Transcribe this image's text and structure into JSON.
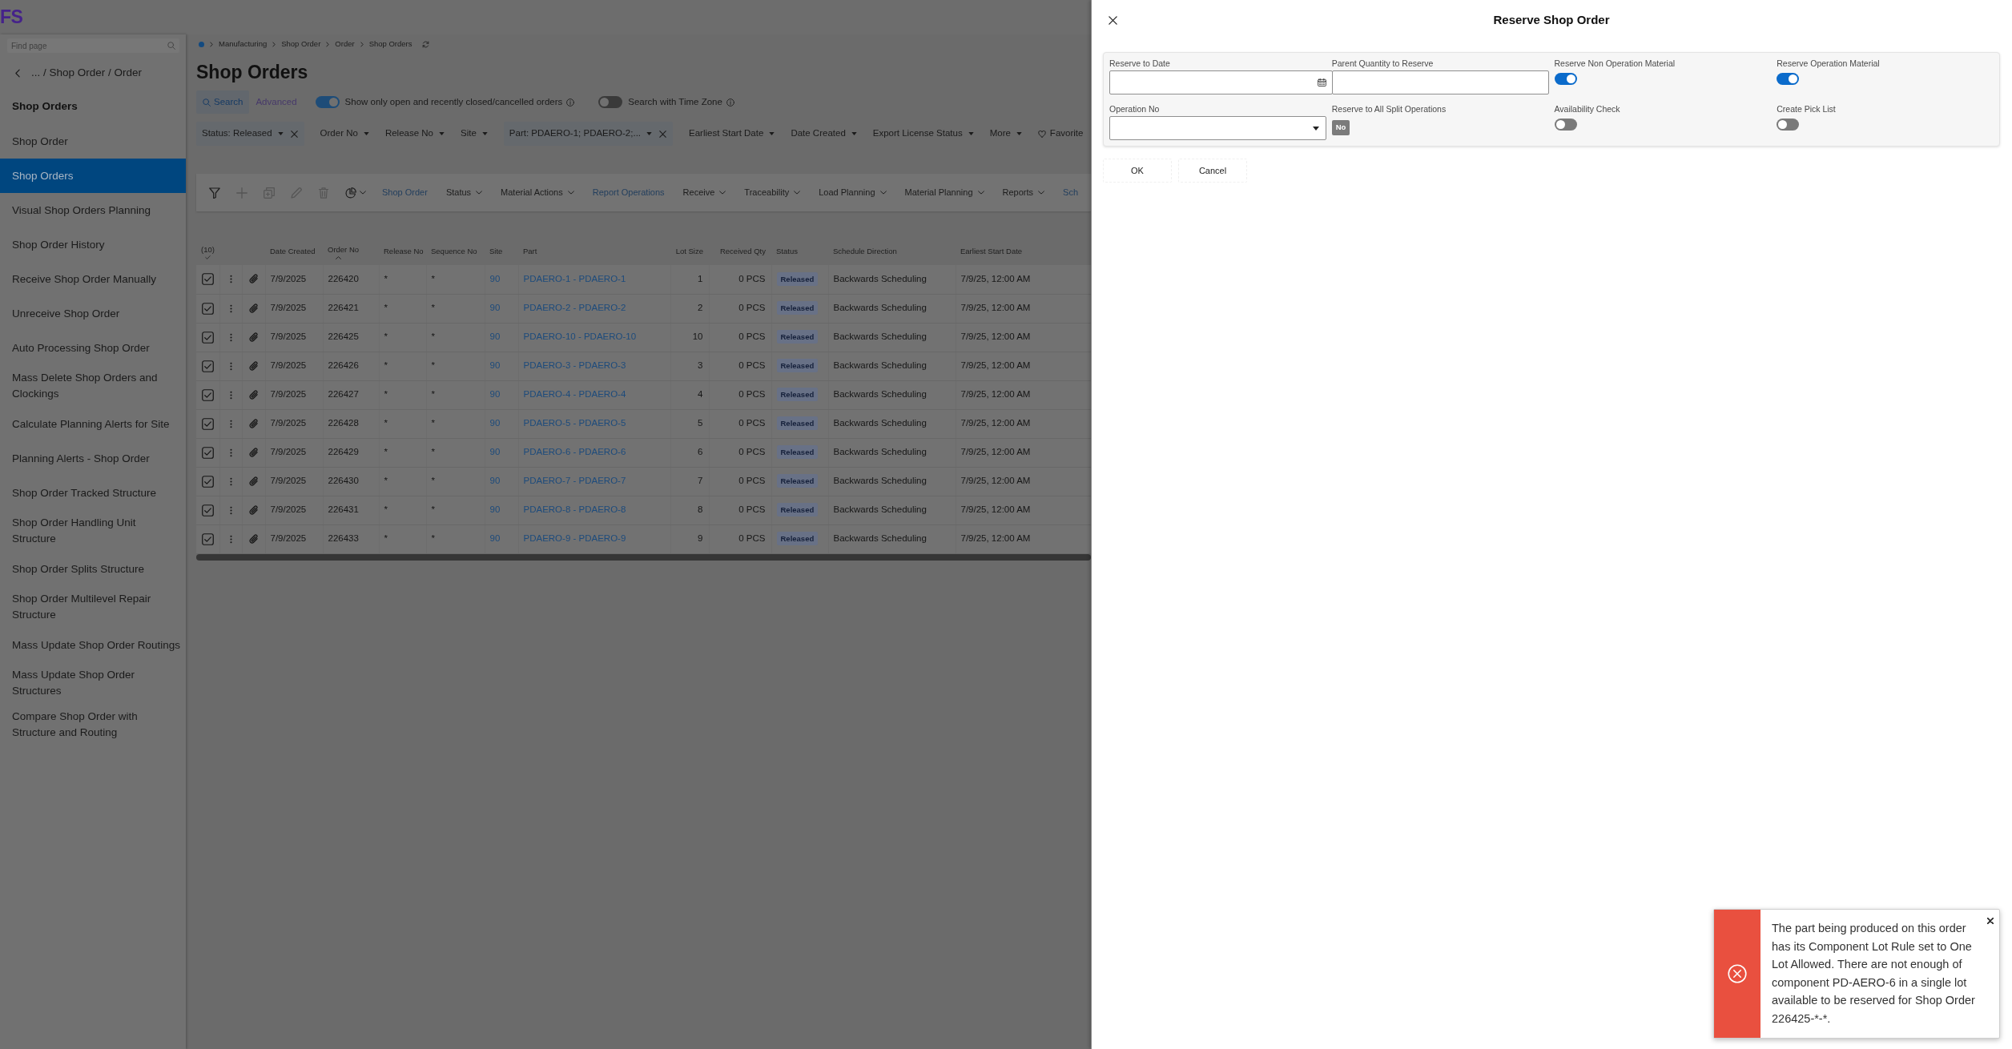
{
  "app": {
    "logo": "FS"
  },
  "sidebar": {
    "search": {
      "placeholder": "Find page"
    },
    "breadcrumb": "... / Shop Order / Order",
    "heading": "Shop Orders",
    "items": [
      {
        "label": "Shop Order",
        "selected": false
      },
      {
        "label": "Shop Orders",
        "selected": true
      },
      {
        "label": "Visual Shop Orders Planning",
        "selected": false
      },
      {
        "label": "Shop Order History",
        "selected": false
      },
      {
        "label": "Receive Shop Order Manually",
        "selected": false
      },
      {
        "label": "Unreceive Shop Order",
        "selected": false
      },
      {
        "label": "Auto Processing Shop Order",
        "selected": false
      },
      {
        "label": "Mass Delete Shop Orders and Clockings",
        "selected": false
      },
      {
        "label": "Calculate Planning Alerts for Site",
        "selected": false
      },
      {
        "label": "Planning Alerts - Shop Order",
        "selected": false
      },
      {
        "label": "Shop Order Tracked Structure",
        "selected": false
      },
      {
        "label": "Shop Order Handling Unit Structure",
        "selected": false
      },
      {
        "label": "Shop Order Splits Structure",
        "selected": false
      },
      {
        "label": "Shop Order Multilevel Repair Structure",
        "selected": false
      },
      {
        "label": "Mass Update Shop Order Routings",
        "selected": false
      },
      {
        "label": "Mass Update Shop Order Structures",
        "selected": false
      },
      {
        "label": "Compare Shop Order with Structure and Routing",
        "selected": false
      }
    ]
  },
  "page": {
    "breadcrumb": [
      "Manufacturing",
      "Shop Order",
      "Order",
      "Shop Orders"
    ],
    "title": "Shop Orders",
    "search_modes": [
      {
        "label": "Search",
        "selected": true
      },
      {
        "label": "Advanced",
        "selected": false
      }
    ],
    "switches": [
      {
        "label": "Show only open and recently closed/cancelled orders",
        "on": true
      },
      {
        "label": "Search with Time Zone",
        "on": false
      }
    ],
    "filters": [
      {
        "label": "Status: Released",
        "removable": true
      },
      {
        "label": "Order No",
        "removable": false
      },
      {
        "label": "Release No",
        "removable": false
      },
      {
        "label": "Site",
        "removable": false
      },
      {
        "label": "Part: PDAERO-1; PDAERO-2;...",
        "removable": true
      },
      {
        "label": "Earliest Start Date",
        "removable": false
      },
      {
        "label": "Date Created",
        "removable": false
      },
      {
        "label": "Export License Status",
        "removable": false
      },
      {
        "label": "More",
        "removable": false
      }
    ],
    "favorites": "Favorite"
  },
  "toolbar": {
    "buttons": [
      {
        "kind": "filter",
        "disabled": false,
        "dropdown": false
      },
      {
        "kind": "add",
        "disabled": true,
        "dropdown": false
      },
      {
        "kind": "copy",
        "disabled": true,
        "dropdown": false
      },
      {
        "kind": "edit",
        "disabled": true,
        "dropdown": false
      },
      {
        "kind": "delete",
        "disabled": true,
        "dropdown": false
      },
      {
        "kind": "chart",
        "disabled": false,
        "dropdown": true
      }
    ],
    "menus": [
      {
        "label": "Shop Order",
        "disabled": true,
        "dropdown": false
      },
      {
        "label": "Status",
        "disabled": false,
        "dropdown": true
      },
      {
        "label": "Material Actions",
        "disabled": false,
        "dropdown": true
      },
      {
        "label": "Report Operations",
        "disabled": true,
        "dropdown": false
      },
      {
        "label": "Receive",
        "disabled": false,
        "dropdown": true
      },
      {
        "label": "Traceability",
        "disabled": false,
        "dropdown": true
      },
      {
        "label": "Load Planning",
        "disabled": false,
        "dropdown": true
      },
      {
        "label": "Material Planning",
        "disabled": false,
        "dropdown": true
      },
      {
        "label": "Reports",
        "disabled": false,
        "dropdown": true
      },
      {
        "label": "Sch",
        "disabled": true,
        "dropdown": false
      }
    ]
  },
  "table": {
    "selected_count": "(10)",
    "all_selected": true,
    "columns": [
      {
        "label": "Date Created",
        "sorted": false
      },
      {
        "label": "Order No",
        "sorted": true
      },
      {
        "label": "Release No",
        "sorted": false
      },
      {
        "label": "Sequence No",
        "sorted": false
      },
      {
        "label": "Site",
        "sorted": false
      },
      {
        "label": "Part",
        "sorted": false
      },
      {
        "label": "Lot Size",
        "sorted": false
      },
      {
        "label": "Received Qty",
        "sorted": false
      },
      {
        "label": "Status",
        "sorted": false
      },
      {
        "label": "Schedule Direction",
        "sorted": false
      },
      {
        "label": "Earliest Start Date",
        "sorted": false
      }
    ],
    "rows": [
      {
        "checked": true,
        "cells": [
          "7/9/2025",
          "226420",
          "*",
          "*",
          "90",
          "PDAERO-1 - PDAERO-1",
          "1",
          "0 PCS",
          "Released",
          "Backwards Scheduling",
          "7/9/25, 12:00 AM"
        ]
      },
      {
        "checked": true,
        "cells": [
          "7/9/2025",
          "226421",
          "*",
          "*",
          "90",
          "PDAERO-2 - PDAERO-2",
          "2",
          "0 PCS",
          "Released",
          "Backwards Scheduling",
          "7/9/25, 12:00 AM"
        ]
      },
      {
        "checked": true,
        "cells": [
          "7/9/2025",
          "226425",
          "*",
          "*",
          "90",
          "PDAERO-10 - PDAERO-10",
          "10",
          "0 PCS",
          "Released",
          "Backwards Scheduling",
          "7/9/25, 12:00 AM"
        ]
      },
      {
        "checked": true,
        "cells": [
          "7/9/2025",
          "226426",
          "*",
          "*",
          "90",
          "PDAERO-3 - PDAERO-3",
          "3",
          "0 PCS",
          "Released",
          "Backwards Scheduling",
          "7/9/25, 12:00 AM"
        ]
      },
      {
        "checked": true,
        "cells": [
          "7/9/2025",
          "226427",
          "*",
          "*",
          "90",
          "PDAERO-4 - PDAERO-4",
          "4",
          "0 PCS",
          "Released",
          "Backwards Scheduling",
          "7/9/25, 12:00 AM"
        ]
      },
      {
        "checked": true,
        "cells": [
          "7/9/2025",
          "226428",
          "*",
          "*",
          "90",
          "PDAERO-5 - PDAERO-5",
          "5",
          "0 PCS",
          "Released",
          "Backwards Scheduling",
          "7/9/25, 12:00 AM"
        ]
      },
      {
        "checked": true,
        "cells": [
          "7/9/2025",
          "226429",
          "*",
          "*",
          "90",
          "PDAERO-6 - PDAERO-6",
          "6",
          "0 PCS",
          "Released",
          "Backwards Scheduling",
          "7/9/25, 12:00 AM"
        ]
      },
      {
        "checked": true,
        "cells": [
          "7/9/2025",
          "226430",
          "*",
          "*",
          "90",
          "PDAERO-7 - PDAERO-7",
          "7",
          "0 PCS",
          "Released",
          "Backwards Scheduling",
          "7/9/25, 12:00 AM"
        ]
      },
      {
        "checked": true,
        "cells": [
          "7/9/2025",
          "226431",
          "*",
          "*",
          "90",
          "PDAERO-8 - PDAERO-8",
          "8",
          "0 PCS",
          "Released",
          "Backwards Scheduling",
          "7/9/25, 12:00 AM"
        ]
      },
      {
        "checked": true,
        "cells": [
          "7/9/2025",
          "226433",
          "*",
          "*",
          "90",
          "PDAERO-9 - PDAERO-9",
          "9",
          "0 PCS",
          "Released",
          "Backwards Scheduling",
          "7/9/25, 12:00 AM"
        ]
      }
    ]
  },
  "dialog": {
    "title": "Reserve Shop Order",
    "fields": [
      {
        "kind": "date",
        "label": "Reserve to Date"
      },
      {
        "kind": "text",
        "label": "Parent Quantity to Reserve"
      },
      {
        "kind": "switch",
        "label": "Reserve Non Operation Material",
        "on": true
      },
      {
        "kind": "switch",
        "label": "Reserve Operation Material",
        "on": true
      },
      {
        "kind": "select",
        "label": "Operation No"
      },
      {
        "kind": "badge",
        "label": "Reserve to All Split Operations",
        "value": "No"
      },
      {
        "kind": "switch",
        "label": "Availability Check",
        "on": false
      },
      {
        "kind": "switch",
        "label": "Create Pick List",
        "on": false
      }
    ],
    "buttons": [
      "OK",
      "Cancel"
    ]
  },
  "toast": {
    "kind": "error",
    "message": "The part being produced on this order has its Component Lot Rule set to One Lot Allowed. There are not enough of component PD-AERO-6 in a single lot available to be reserved for Shop Order 226425-*-*."
  }
}
